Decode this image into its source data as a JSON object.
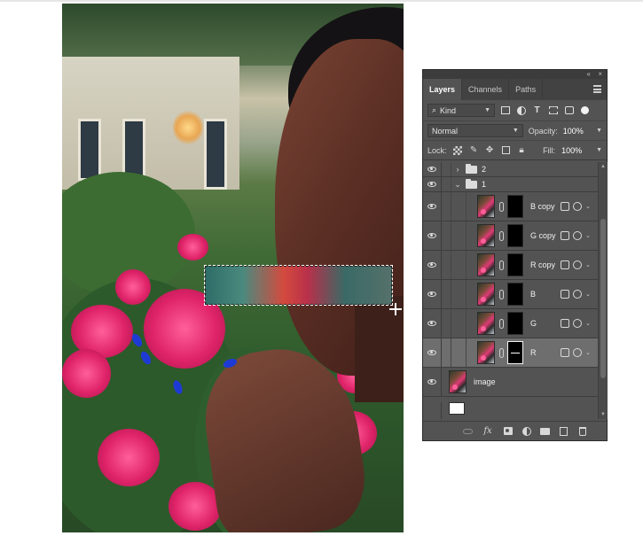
{
  "panel": {
    "tabs": [
      {
        "label": "Layers",
        "active": true
      },
      {
        "label": "Channels",
        "active": false
      },
      {
        "label": "Paths",
        "active": false
      }
    ],
    "collapse_glyph": "«",
    "close_glyph": "×",
    "filter": {
      "kind_label": "Kind",
      "icons": [
        "image-filter-icon",
        "adjustment-filter-icon",
        "type-filter-icon",
        "shape-filter-icon",
        "smart-object-filter-icon",
        "filter-toggle-icon"
      ],
      "type_glyph": "T"
    },
    "blend_mode": "Normal",
    "opacity_label": "Opacity:",
    "opacity_value": "100%",
    "lock_label": "Lock:",
    "fill_label": "Fill:",
    "fill_value": "100%",
    "layers": [
      {
        "kind": "group",
        "name": "2",
        "expanded": false,
        "visible": true
      },
      {
        "kind": "group",
        "name": "1",
        "expanded": true,
        "visible": true
      },
      {
        "kind": "layer",
        "name": "B copy",
        "visible": true,
        "selected": false
      },
      {
        "kind": "layer",
        "name": "G copy",
        "visible": true,
        "selected": false
      },
      {
        "kind": "layer",
        "name": "R copy",
        "visible": true,
        "selected": false
      },
      {
        "kind": "layer",
        "name": "B",
        "visible": true,
        "selected": false
      },
      {
        "kind": "layer",
        "name": "G",
        "visible": true,
        "selected": false
      },
      {
        "kind": "layer",
        "name": "R",
        "visible": true,
        "selected": true
      },
      {
        "kind": "layer",
        "name": "image",
        "visible": true,
        "selected": false
      },
      {
        "kind": "background",
        "name": "",
        "visible": false
      }
    ],
    "footer_icons": [
      "link-layers-icon",
      "fx-icon",
      "add-mask-icon",
      "adjustment-layer-icon",
      "new-group-icon",
      "new-layer-icon",
      "delete-layer-icon"
    ],
    "fx_label": "fx"
  },
  "colors": {
    "panel_bg": "#535353",
    "selected_row": "#6e6e6e",
    "nail_polish": "#1e3ad4",
    "flowers": "#e0246a"
  }
}
